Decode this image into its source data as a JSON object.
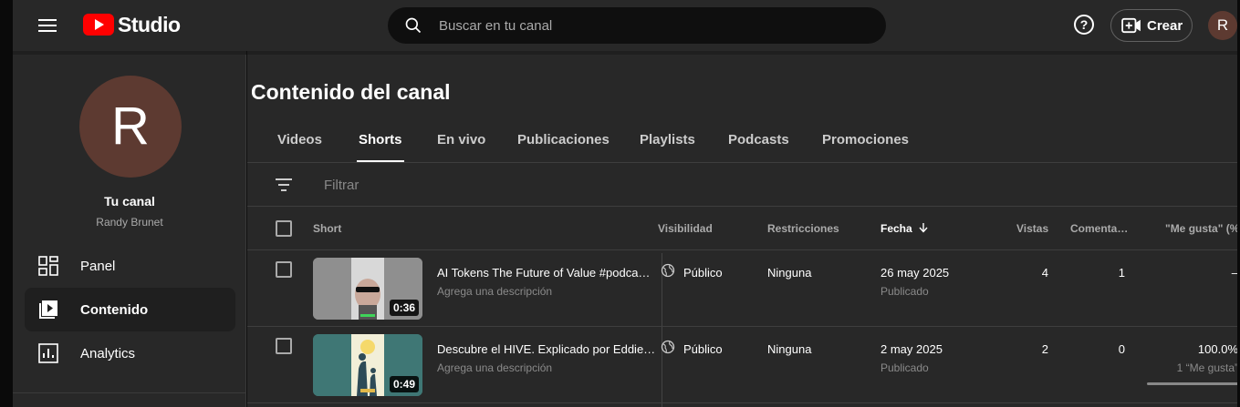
{
  "header": {
    "logo_text": "Studio",
    "search_placeholder": "Buscar en tu canal",
    "help_label": "?",
    "create_label": "Crear",
    "avatar_initial": "R"
  },
  "sidebar": {
    "avatar_initial": "R",
    "channel_title": "Tu canal",
    "channel_name": "Randy Brunet",
    "items": [
      {
        "label": "Panel",
        "icon": "dashboard-icon"
      },
      {
        "label": "Contenido",
        "icon": "content-icon",
        "active": true
      },
      {
        "label": "Analytics",
        "icon": "analytics-icon"
      }
    ]
  },
  "main": {
    "title": "Contenido del canal",
    "tabs": [
      {
        "label": "Videos"
      },
      {
        "label": "Shorts",
        "active": true
      },
      {
        "label": "En vivo"
      },
      {
        "label": "Publicaciones"
      },
      {
        "label": "Playlists"
      },
      {
        "label": "Podcasts"
      },
      {
        "label": "Promociones"
      }
    ],
    "filter_placeholder": "Filtrar",
    "columns": {
      "short": "Short",
      "visibility": "Visibilidad",
      "restrictions": "Restricciones",
      "date": "Fecha",
      "views": "Vistas",
      "comments": "Comenta…",
      "likes": "\"Me gusta\" (%)"
    },
    "rows": [
      {
        "duration": "0:36",
        "title": "AI Tokens The Future of Value #podca…",
        "description": "Agrega una descripción",
        "visibility": "Público",
        "restrictions": "Ninguna",
        "date": "26 may 2025",
        "status": "Publicado",
        "views": "4",
        "comments": "1",
        "likes": "–",
        "likes_sub": ""
      },
      {
        "duration": "0:49",
        "title": "Descubre el HIVE. Explicado por Eddie…",
        "description": "Agrega una descripción",
        "visibility": "Público",
        "restrictions": "Ninguna",
        "date": "2 may 2025",
        "status": "Publicado",
        "views": "2",
        "comments": "0",
        "likes": "100.0%",
        "likes_sub": "1 “Me gusta”"
      }
    ]
  },
  "colors": {
    "brand_red": "#ff0000",
    "avatar_bg": "#5d3a31",
    "surface": "#282828"
  }
}
